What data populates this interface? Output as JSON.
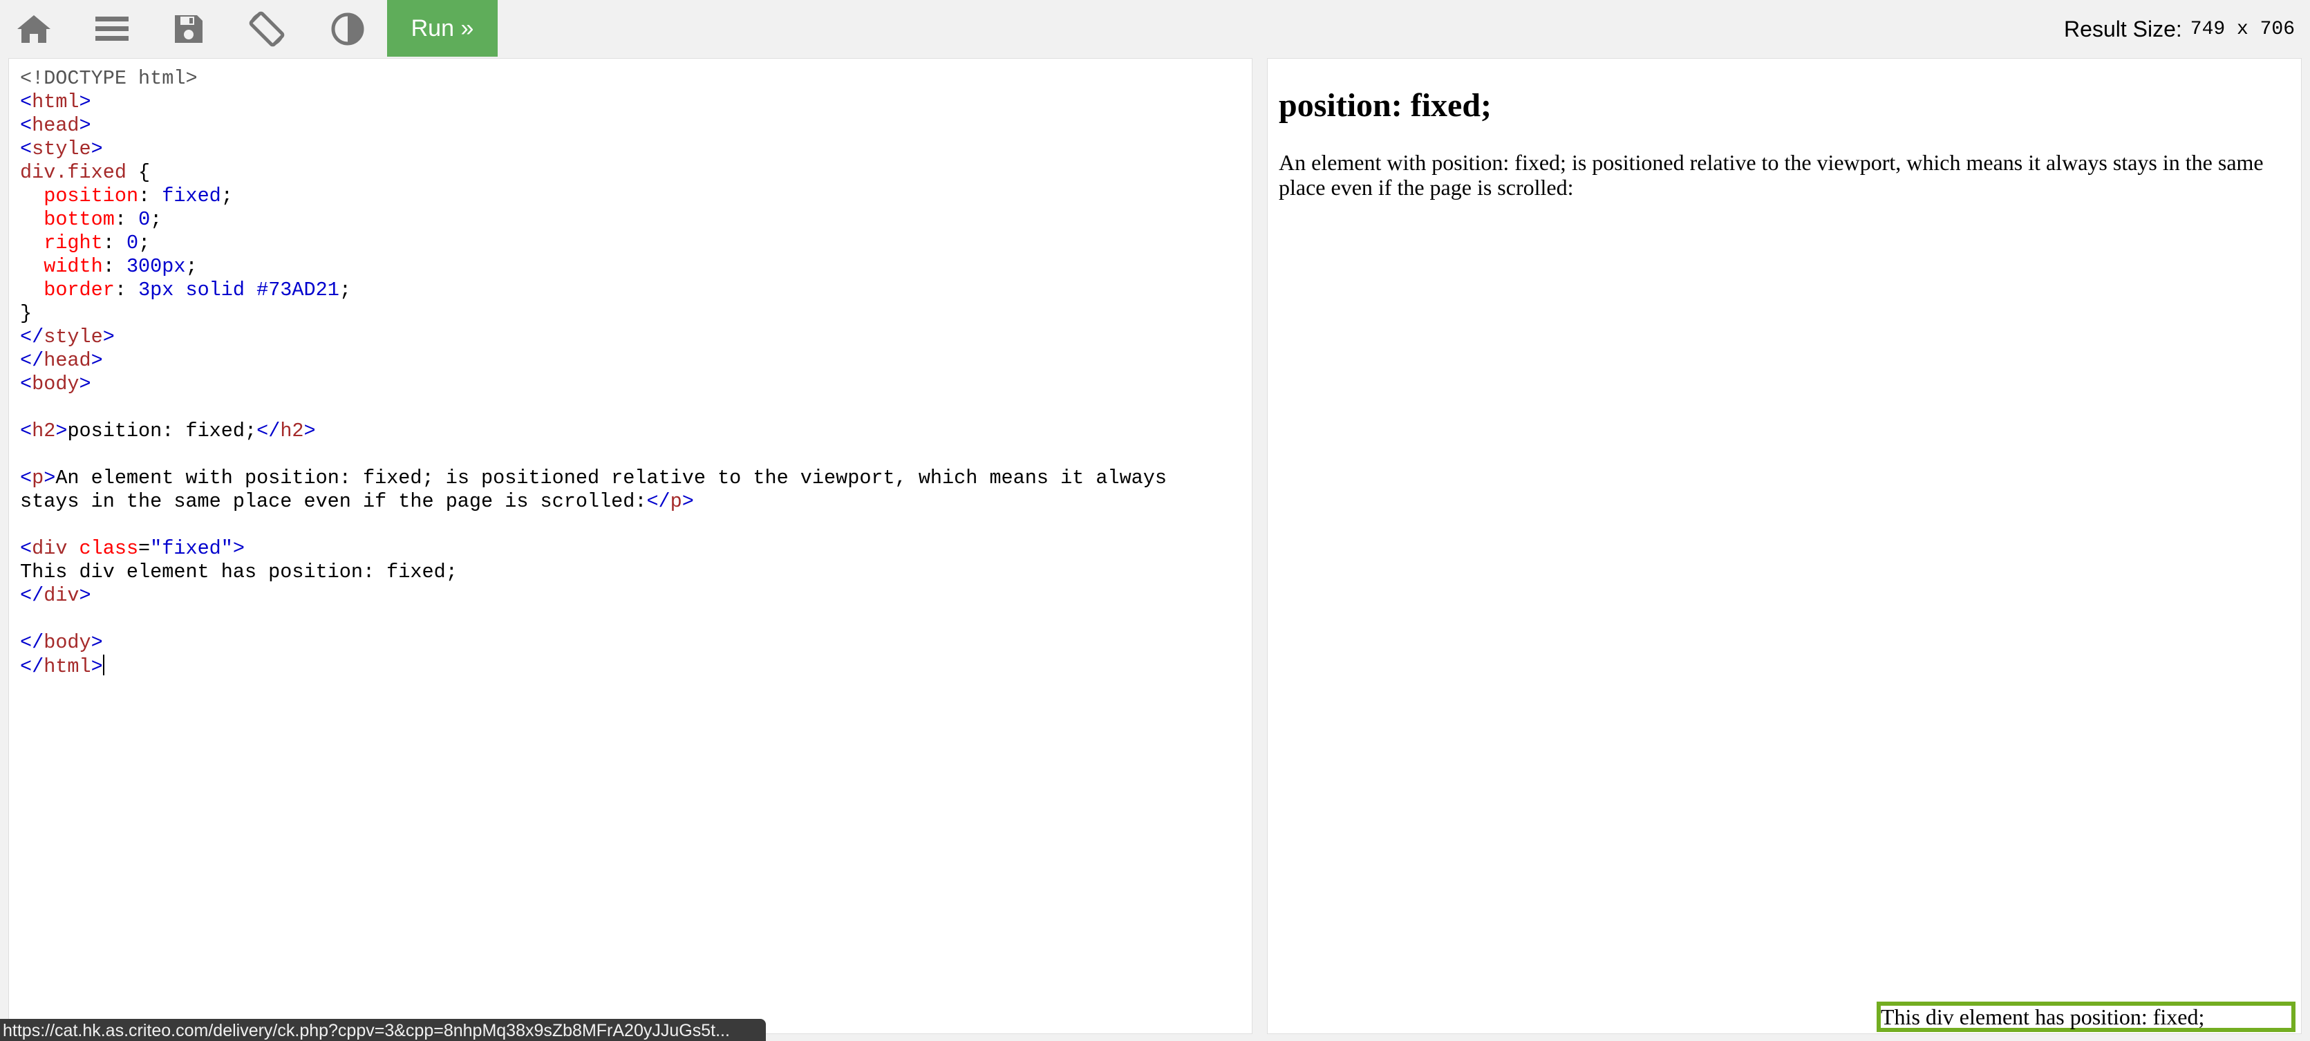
{
  "toolbar": {
    "icons": [
      "home-icon",
      "menu-icon",
      "save-icon",
      "rotate-icon",
      "contrast-icon"
    ],
    "run_label": "Run »",
    "result_size_label": "Result Size:",
    "result_size_value": "749 x 706",
    "run_color": "#5fad5a",
    "icon_color": "#757575"
  },
  "editor": {
    "lines": [
      "<!DOCTYPE html>",
      "<html>",
      "<head>",
      "<style>",
      "div.fixed {",
      "  position: fixed;",
      "  bottom: 0;",
      "  right: 0;",
      "  width: 300px;",
      "  border: 3px solid #73AD21;",
      "}",
      "</style>",
      "</head>",
      "<body>",
      "",
      "<h2>position: fixed;</h2>",
      "",
      "<p>An element with position: fixed; is positioned relative to the viewport, which means it always",
      "stays in the same place even if the page is scrolled:</p>",
      "",
      "<div class=\"fixed\">",
      "This div element has position: fixed;",
      "</div>",
      "",
      "</body>",
      "</html>"
    ]
  },
  "result": {
    "heading": "position: fixed;",
    "paragraph": "An element with position: fixed; is positioned relative to the viewport, which means it always stays in the same place even if the page is scrolled:",
    "fixed_div_text": "This div element has position: fixed;",
    "fixed_border_color": "#73AD21"
  },
  "status_bar": {
    "url": "https://cat.hk.as.criteo.com/delivery/ck.php?cppv=3&cpp=8nhpMq38x9sZb8MFrA20yJJuGs5t..."
  }
}
